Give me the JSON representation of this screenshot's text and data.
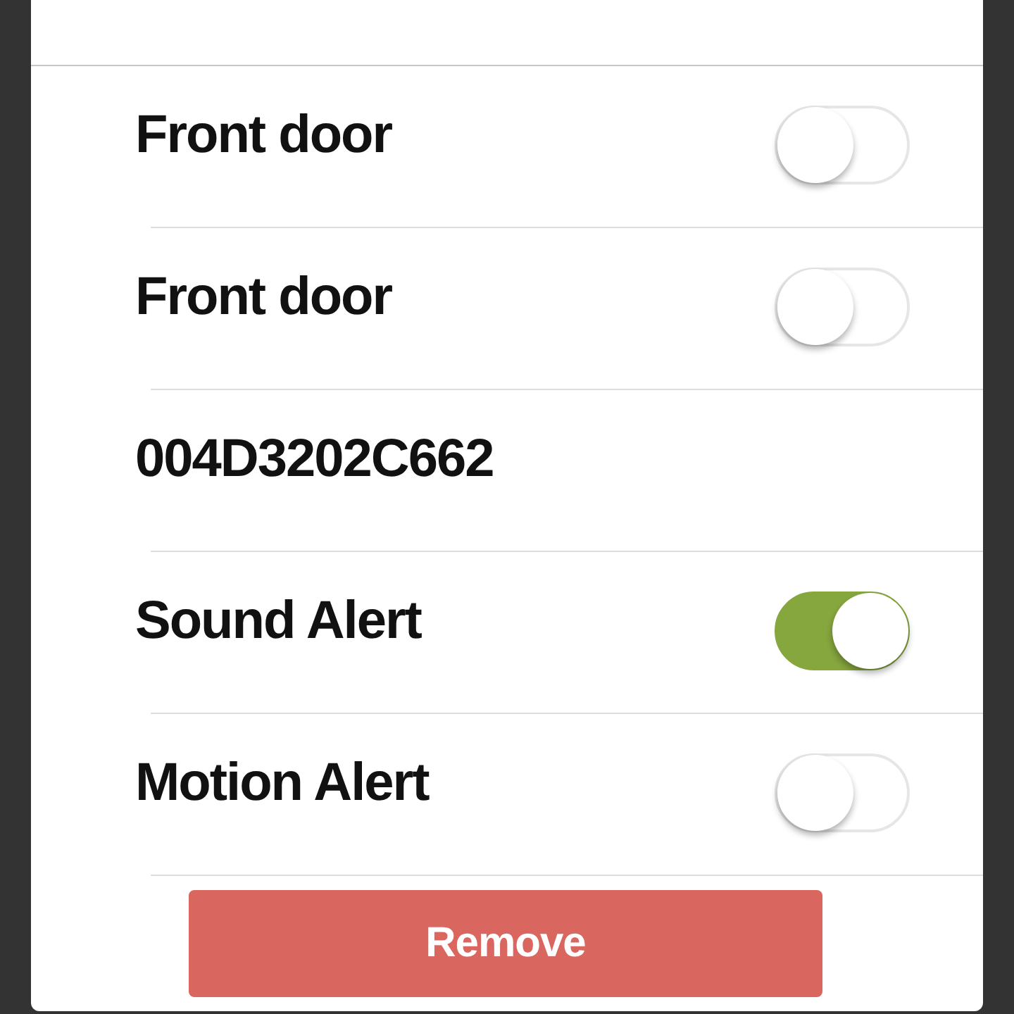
{
  "rows": [
    {
      "label": "Front door",
      "kind": "toggle",
      "on": false
    },
    {
      "label": "Front door",
      "kind": "toggle",
      "on": false
    },
    {
      "label": "004D3202C662",
      "kind": "text"
    },
    {
      "label": "Sound Alert",
      "kind": "toggle",
      "on": true
    },
    {
      "label": "Motion Alert",
      "kind": "toggle",
      "on": false
    }
  ],
  "remove_button": {
    "label": "Remove"
  }
}
